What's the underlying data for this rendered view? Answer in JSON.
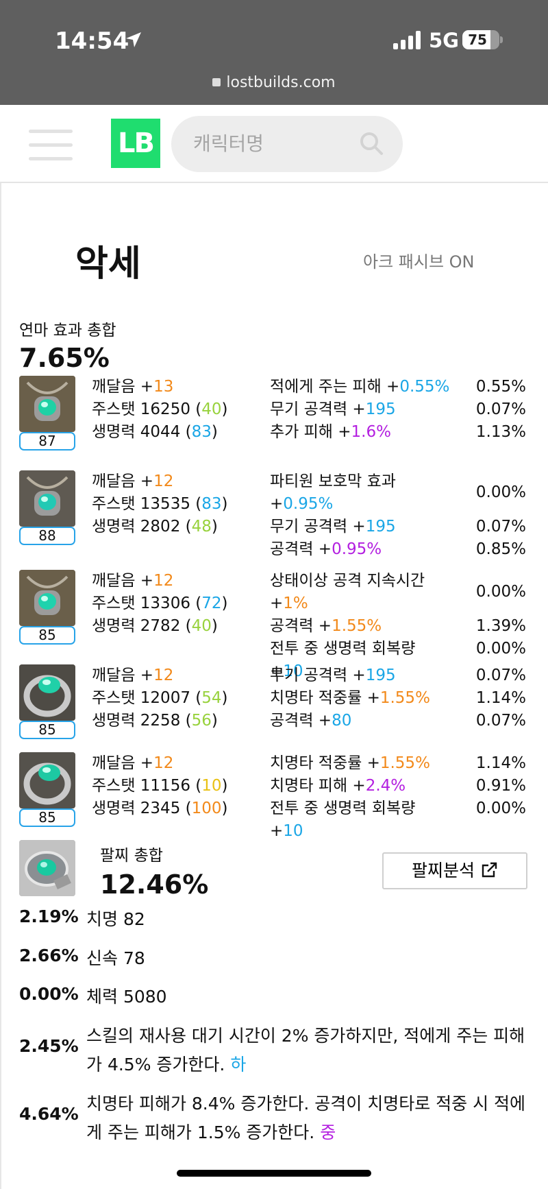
{
  "status_bar": {
    "time": "14:54",
    "network": "5G",
    "battery": "75",
    "battery_level": 0.75
  },
  "browser": {
    "url": "lostbuilds.com"
  },
  "header": {
    "logo": "LB",
    "search_placeholder": "캐릭터명",
    "icons": [
      "menu-icon",
      "search-icon"
    ]
  },
  "section": {
    "title": "악세",
    "ark_passive": "아크 패시브 ON"
  },
  "refine": {
    "label": "연마 효과 총합",
    "value": "7.65%"
  },
  "items": [
    {
      "level": "87",
      "stats": [
        {
          "label": "깨달음 +",
          "value": "13",
          "color": "orange"
        },
        {
          "label": "주스탯 16250 (",
          "value": "40",
          "color": "green",
          "suffix": ")"
        },
        {
          "label": "생명력 4044 (",
          "value": "83",
          "color": "blue",
          "suffix": ")"
        }
      ],
      "effects": [
        {
          "text": "적에게 주는 피해 +",
          "value": "0.55%",
          "color": "blue",
          "pct": "0.55%"
        },
        {
          "text": "무기 공격력 +",
          "value": "195",
          "color": "blue",
          "pct": "0.07%"
        },
        {
          "text": "추가 피해 +",
          "value": "1.6%",
          "color": "purple",
          "pct": "1.13%"
        }
      ]
    },
    {
      "level": "88",
      "stats": [
        {
          "label": "깨달음 +",
          "value": "12",
          "color": "orange"
        },
        {
          "label": "주스탯 13535 (",
          "value": "83",
          "color": "blue",
          "suffix": ")"
        },
        {
          "label": "생명력 2802 (",
          "value": "48",
          "color": "green",
          "suffix": ")"
        }
      ],
      "effects": [
        {
          "text": "파티원 보호막 효과",
          "text2": "+",
          "value": "0.95%",
          "color": "blue",
          "pct": "0.00%"
        },
        {
          "text": "무기 공격력 +",
          "value": "195",
          "color": "blue",
          "pct": "0.07%"
        },
        {
          "text": "공격력 +",
          "value": "0.95%",
          "color": "purple",
          "pct": "0.85%"
        }
      ]
    },
    {
      "level": "85",
      "stats": [
        {
          "label": "깨달음 +",
          "value": "12",
          "color": "orange"
        },
        {
          "label": "주스탯 13306 (",
          "value": "72",
          "color": "blue",
          "suffix": ")"
        },
        {
          "label": "생명력 2782 (",
          "value": "40",
          "color": "green",
          "suffix": ")"
        }
      ],
      "effects": [
        {
          "text": "상태이상 공격 지속시간",
          "text2": "+",
          "value": "1%",
          "color": "orange",
          "pct": "0.00%"
        },
        {
          "text": "공격력 +",
          "value": "1.55%",
          "color": "orange",
          "pct": "1.39%"
        },
        {
          "text": "전투 중 생명력 회복량 +",
          "value": "10",
          "color": "blue",
          "pct": "0.00%"
        }
      ]
    },
    {
      "level": "85",
      "stats": [
        {
          "label": "깨달음 +",
          "value": "12",
          "color": "orange"
        },
        {
          "label": "주스탯 12007 (",
          "value": "54",
          "color": "green",
          "suffix": ")"
        },
        {
          "label": "생명력 2258 (",
          "value": "56",
          "color": "green",
          "suffix": ")"
        }
      ],
      "effects": [
        {
          "text": "무기 공격력 +",
          "value": "195",
          "color": "blue",
          "pct": "0.07%"
        },
        {
          "text": "치명타 적중률 +",
          "value": "1.55%",
          "color": "orange",
          "pct": "1.14%"
        },
        {
          "text": "공격력 +",
          "value": "80",
          "color": "blue",
          "pct": "0.07%"
        }
      ]
    },
    {
      "level": "85",
      "stats": [
        {
          "label": "깨달음 +",
          "value": "12",
          "color": "orange"
        },
        {
          "label": "주스탯 11156 (",
          "value": "10",
          "color": "yellow",
          "suffix": ")"
        },
        {
          "label": "생명력 2345 (",
          "value": "100",
          "color": "orange",
          "suffix": ")"
        }
      ],
      "effects": [
        {
          "text": "치명타 적중률 +",
          "value": "1.55%",
          "color": "orange",
          "pct": "1.14%"
        },
        {
          "text": "치명타 피해 +",
          "value": "2.4%",
          "color": "purple",
          "pct": "0.91%"
        },
        {
          "text": "전투 중 생명력 회복량 +",
          "value": "10",
          "color": "blue",
          "pct": "0.00%"
        }
      ]
    }
  ],
  "bracelet": {
    "label": "팔찌 총합",
    "value": "12.46%",
    "button": "팔찌분석",
    "rows": [
      {
        "pct": "2.19%",
        "text": "치명 82"
      },
      {
        "pct": "2.66%",
        "text": "신속 78"
      },
      {
        "pct": "0.00%",
        "text": "체력 5080"
      },
      {
        "pct": "2.45%",
        "text": "스킬의 재사용 대기 시간이 2% 증가하지만, 적에게 주는 피해가 4.5% 증가한다. ",
        "grade": "하",
        "grade_color": "blue"
      },
      {
        "pct": "4.64%",
        "text": "치명타 피해가 8.4% 증가한다. 공격이 치명타로 적중 시 적에게 주는 피해가 1.5% 증가한다. ",
        "grade": "중",
        "grade_color": "purple"
      }
    ]
  }
}
